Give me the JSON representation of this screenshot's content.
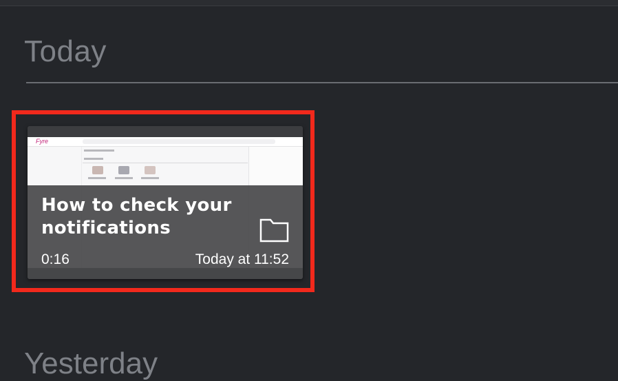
{
  "section": {
    "title": "Today"
  },
  "next_section": {
    "title": "Yesterday"
  },
  "card": {
    "title": "How to check your notifications",
    "duration": "0:16",
    "timestamp": "Today at 11:52",
    "thumbnail_logo": "Fyre",
    "folder_icon": "folder-icon"
  },
  "colors": {
    "background": "#24262a",
    "highlight": "#f2291c",
    "overlay": "#48484a",
    "text": "#ffffff",
    "section_title": "#7e8187"
  }
}
